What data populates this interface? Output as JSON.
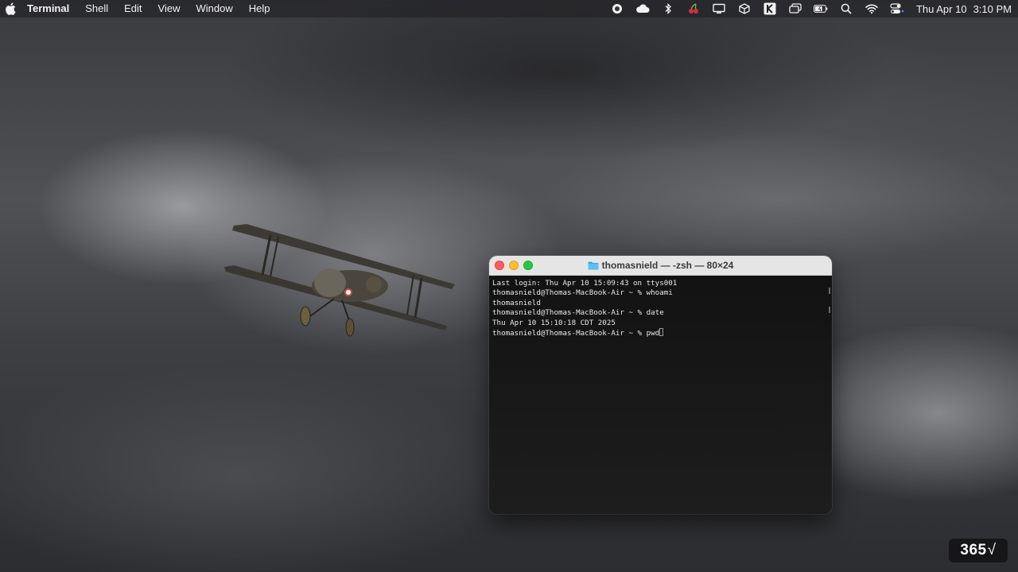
{
  "menubar": {
    "app_name": "Terminal",
    "items": [
      "Shell",
      "Edit",
      "View",
      "Window",
      "Help"
    ],
    "clock_date": "Thu Apr 10",
    "clock_time": "3:10 PM"
  },
  "status_icons": [
    "screen-record-icon",
    "icloud-icon",
    "bluetooth-icon",
    "cherry-icon",
    "display-icon",
    "package-icon",
    "keyboard-maestro-icon",
    "window-icon",
    "battery-icon",
    "search-icon",
    "wifi-icon",
    "control-center-icon"
  ],
  "terminal": {
    "title": "thomasnield — -zsh — 80×24",
    "lines": [
      "Last login: Thu Apr 10 15:09:43 on ttys001",
      "thomasnield@Thomas-MacBook-Air ~ % whoami",
      "thomasnield",
      "thomasnield@Thomas-MacBook-Air ~ % date",
      "Thu Apr 10 15:10:18 CDT 2025",
      "thomasnield@Thomas-MacBook-Air ~ % pwd"
    ]
  },
  "watermark": {
    "text": "365",
    "mark": "√"
  },
  "colors": {
    "close": "#fe5f57",
    "minimize": "#febc2e",
    "maximize": "#28c840",
    "terminal_bg": "#161616",
    "titlebar_bg": "#e6e5e5"
  }
}
